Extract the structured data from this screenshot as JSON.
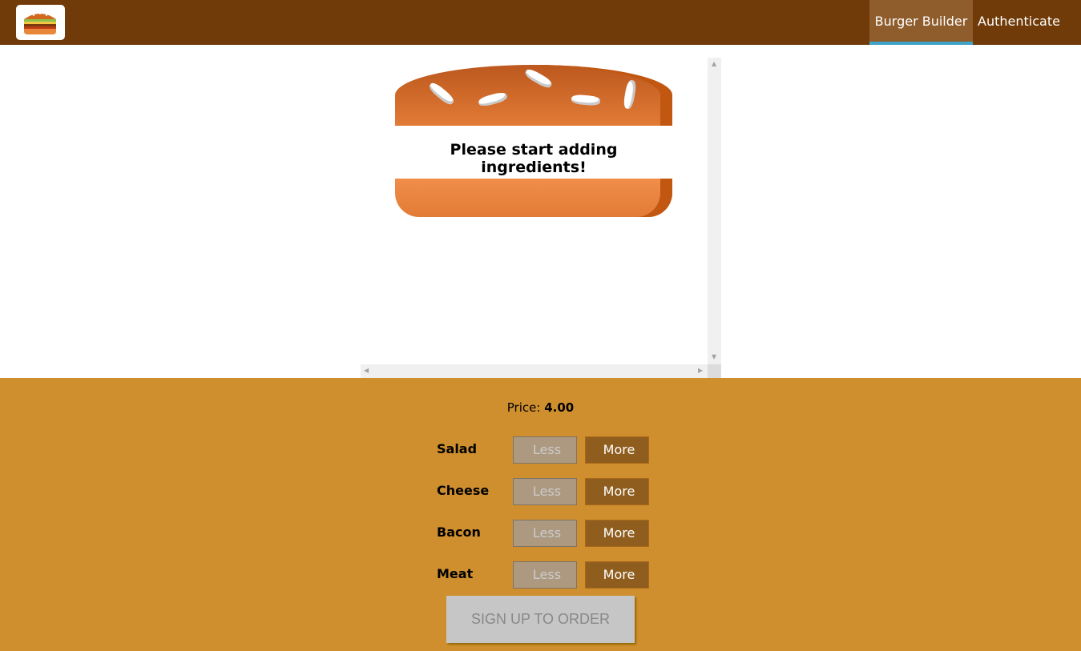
{
  "toolbar": {
    "logo": "burger-logo-icon",
    "nav": [
      {
        "label": "Burger Builder",
        "active": true
      },
      {
        "label": "Authenticate",
        "active": false
      }
    ]
  },
  "burger": {
    "empty_message": "Please start adding ingredients!"
  },
  "controls": {
    "price_label": "Price:",
    "price_value": "4.00",
    "ingredients": [
      {
        "label": "Salad",
        "less": "Less",
        "more": "More"
      },
      {
        "label": "Cheese",
        "less": "Less",
        "more": "More"
      },
      {
        "label": "Bacon",
        "less": "Less",
        "more": "More"
      },
      {
        "label": "Meat",
        "less": "Less",
        "more": "More"
      }
    ],
    "order_button": "SIGN UP TO ORDER"
  },
  "colors": {
    "toolbar": "#703b09",
    "controls_bg": "#cf8f2e",
    "active_nav": "#8f5c2c",
    "active_underline": "#40a4c8"
  }
}
